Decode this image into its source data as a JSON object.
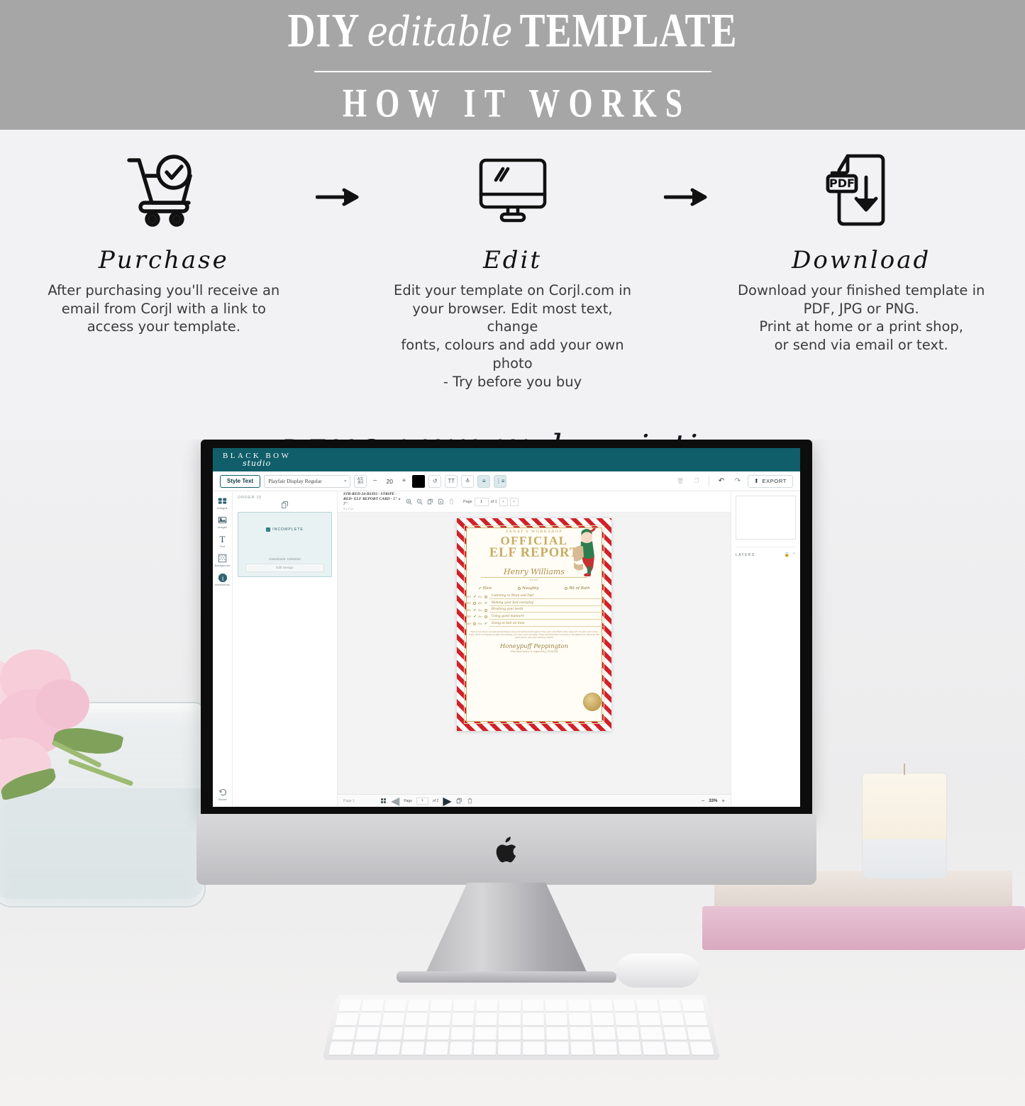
{
  "banner": {
    "title_part1": "DIY",
    "title_script": "editable",
    "title_part2": "TEMPLATE",
    "subtitle": "HOW IT WORKS"
  },
  "steps": [
    {
      "icon": "shopping-cart-check-icon",
      "title": "Purchase",
      "body": "After purchasing you'll receive an\nemail from Corjl with a link to\naccess your template."
    },
    {
      "icon": "desktop-monitor-edit-icon",
      "title": "Edit",
      "body": "Edit your template on Corjl.com in\nyour browser. Edit most text, change\nfonts, colours and add your own photo\n- Try before you buy"
    },
    {
      "icon": "pdf-download-icon",
      "title": "Download",
      "body": "Download your finished template in\nPDF, JPG or PNG.\nPrint at home or a print shop,\nor send via email or text."
    }
  ],
  "arrow_icon": "arrow-right-icon",
  "demo_link": {
    "caps": "DEMO LINK IN",
    "script": "description"
  },
  "editor": {
    "brand": {
      "name": "BLACK BOW",
      "sub": "studio",
      "header_color": "#0f5e69"
    },
    "toolbar": {
      "style_text_label": "Style Text",
      "font_family_value": "Playfair Display Regular",
      "font_size_value": "20",
      "decrease_label": "−",
      "increase_label": "+",
      "color_swatch": "#000000",
      "text_case_label": "TT",
      "export_label": "EXPORT"
    },
    "rail": [
      {
        "icon": "designs-icon",
        "label": "Designs"
      },
      {
        "icon": "images-icon",
        "label": "Images"
      },
      {
        "icon": "text-icon",
        "label": "Text"
      },
      {
        "icon": "background-icon",
        "label": "Background"
      },
      {
        "icon": "instructions-icon",
        "label": "Instructions"
      }
    ],
    "rail_bottom": {
      "icon": "revert-icon",
      "label": "Revert"
    },
    "left_panel": {
      "order_id_label": "ORDER ID",
      "status_badge": "INCOMPLETE",
      "downloads_label": "Downloads: Unlimited",
      "edit_design_label": "Edit Design"
    },
    "canvas_topbar": {
      "doc_title": "STR-RED-24-B3393 - STRIPE - RED- ELF REPORT CARD - 5\" x 7\"",
      "doc_size": "5 x 7 in",
      "page_label": "Page",
      "page_value": "1",
      "page_of": "of 1",
      "prev_label": "‹",
      "next_label": "›"
    },
    "right_panel": {
      "layers_label": "LAYERS"
    },
    "status_bar": {
      "page_name": "Page 1",
      "page_label": "Page",
      "page_value": "1",
      "page_of": "of 2",
      "zoom_value": "33%",
      "zoom_out": "−",
      "zoom_in": "+"
    },
    "card": {
      "workshop": "SANAT'S WORKSHOP",
      "official": "OFFICIAL",
      "report": "ELF REPORT",
      "name_value": "Henry Williams",
      "name_label": "NAME",
      "verdicts": [
        "Nice",
        "Naughty",
        "Bit of Both"
      ],
      "verdict_selected": "Nice",
      "yes_label": "YES",
      "no_label": "No",
      "tasks": [
        {
          "text": "Listening to Mum and Dad",
          "answer": "yes"
        },
        {
          "text": "Making your bed everyday",
          "answer": "no"
        },
        {
          "text": "Brushing your teeth",
          "answer": "yes"
        },
        {
          "text": "Using good manners",
          "answer": "yes"
        },
        {
          "text": "Going to bed on time",
          "answer": "no"
        }
      ],
      "paragraph": "Henry has shown wonderful kindness and good manners throughout the year, and that's truly magical! To earn even more stars, work on tidying up fast and making your bed each morning. These small habits can make a big difference. Keep up the great work, and keep shining bright!",
      "signature": "Honeypuff Peppington",
      "signature_label": "Checked twice & signed by Chief Elf"
    }
  }
}
